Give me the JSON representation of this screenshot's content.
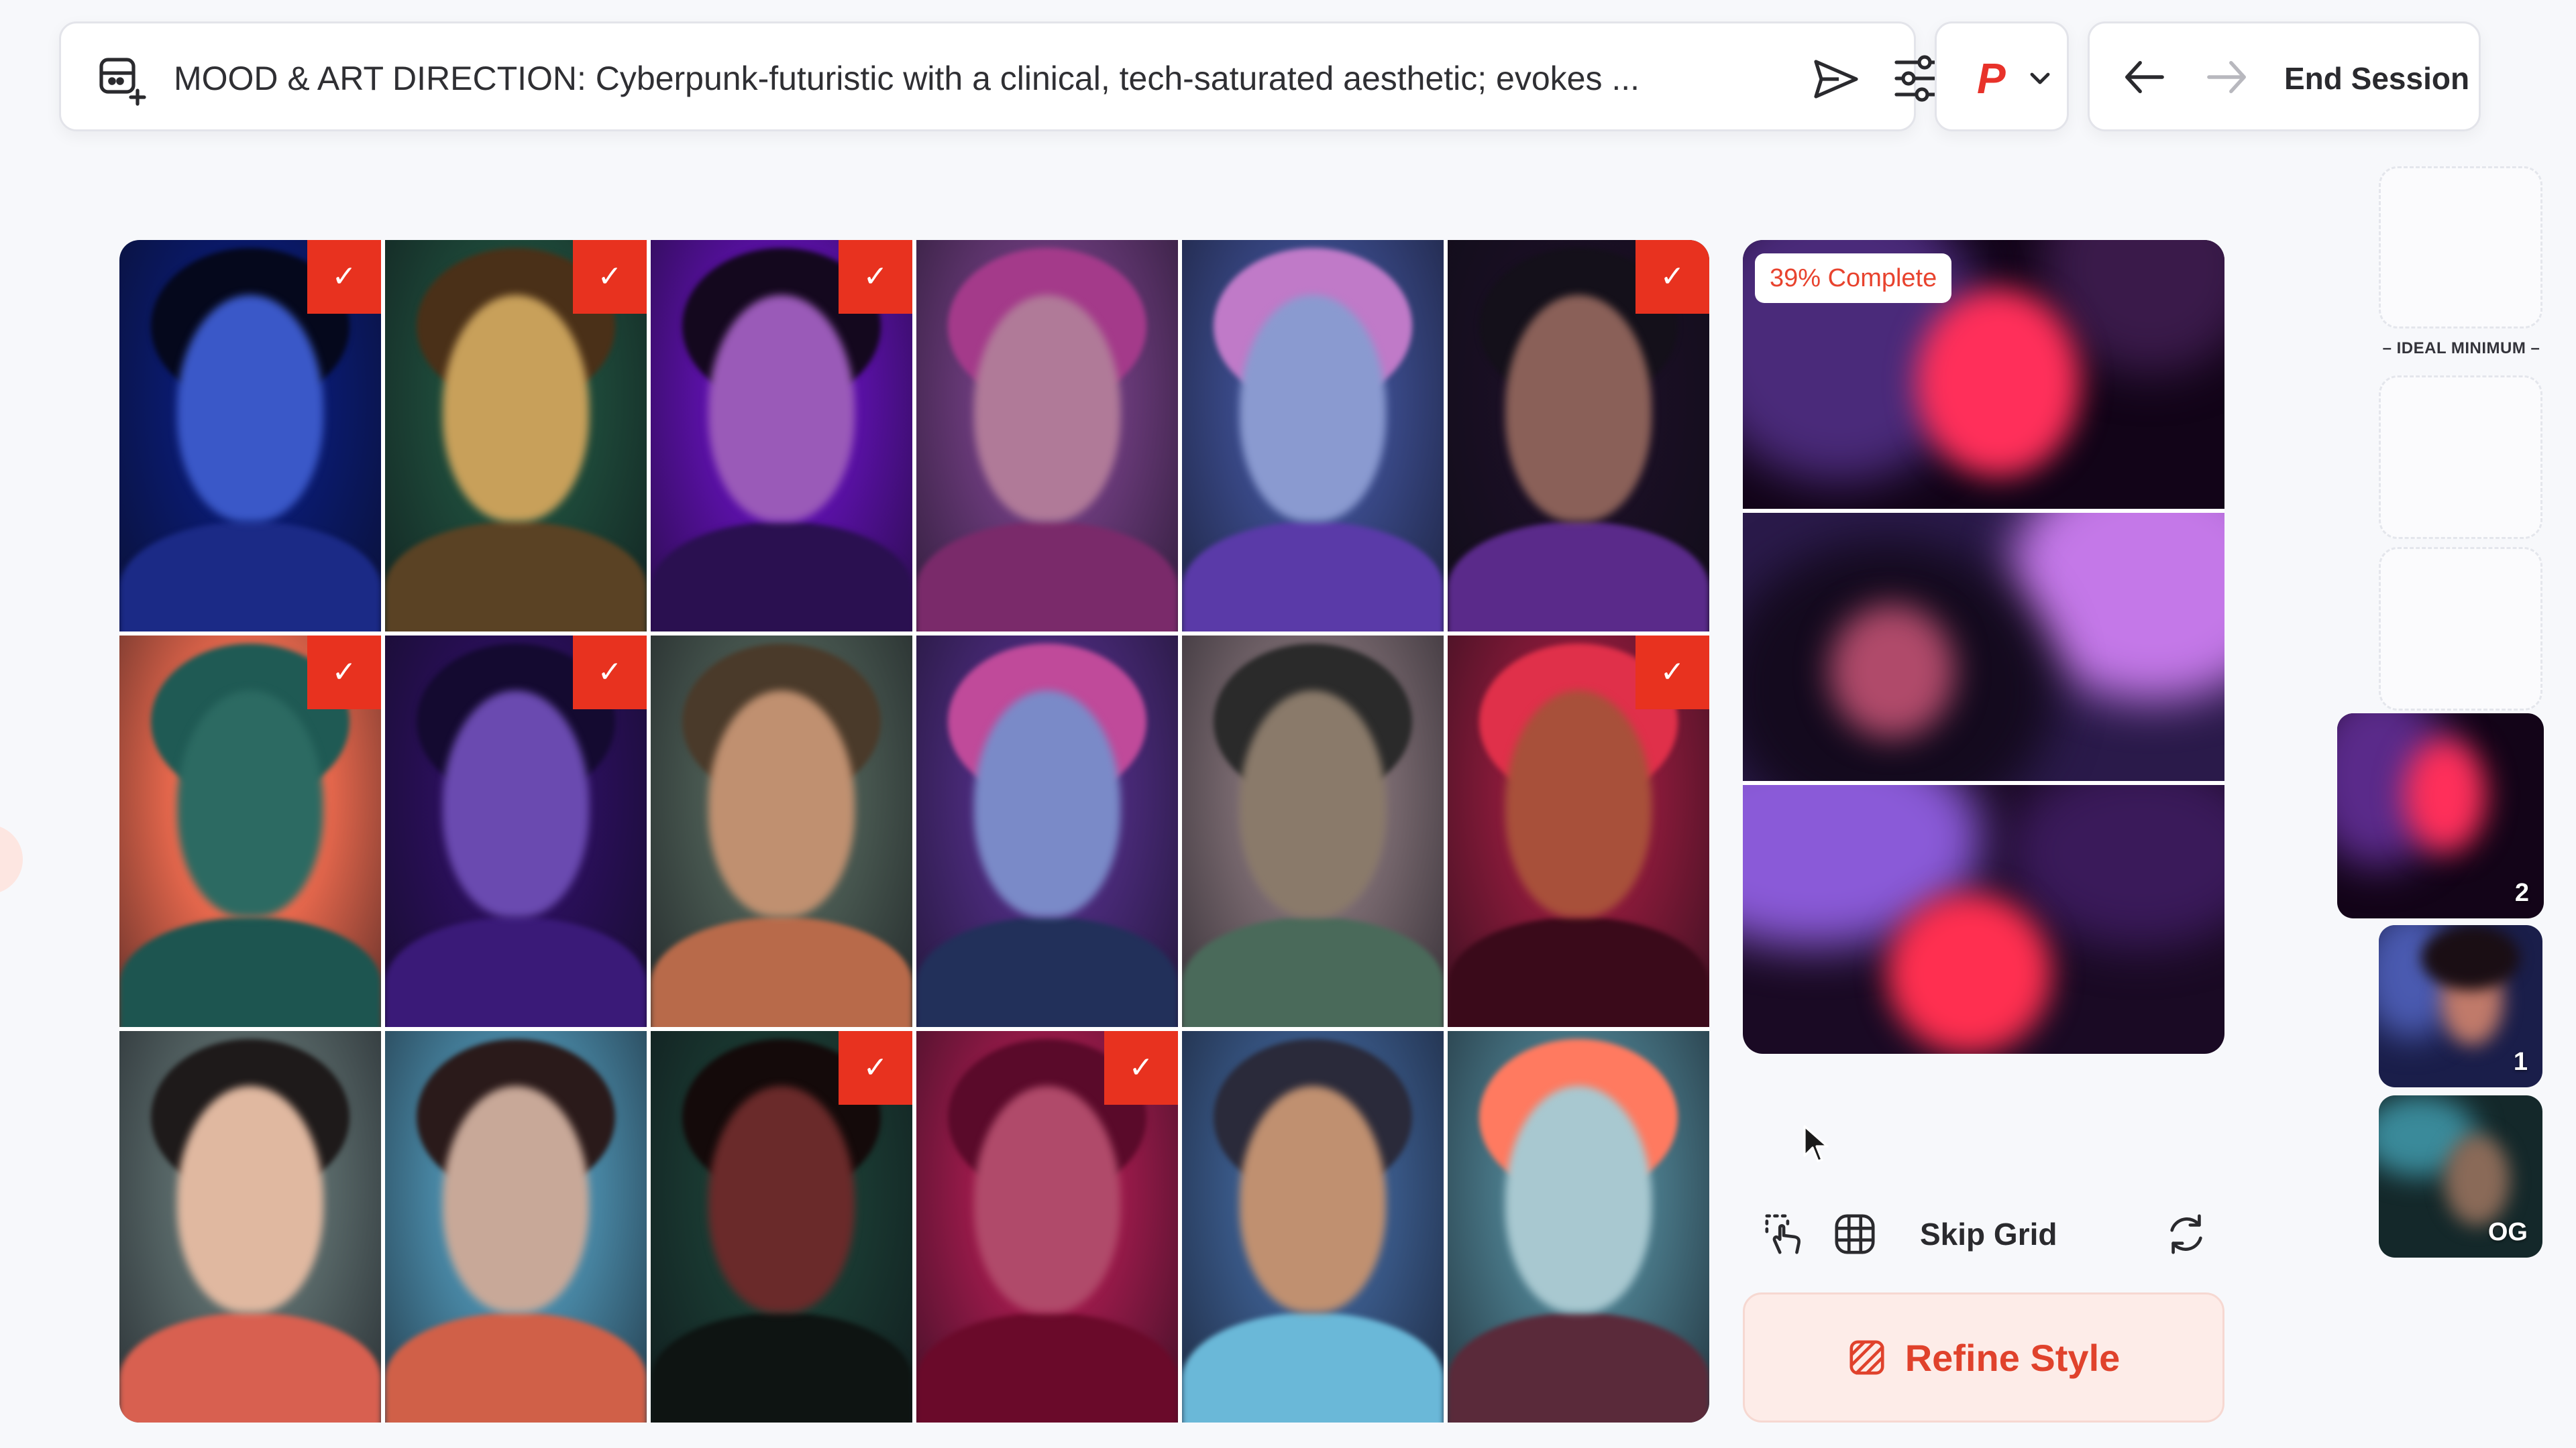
{
  "toolbar": {
    "prompt_text": "MOOD & ART DIRECTION: Cyberpunk-futuristic with a clinical, tech-saturated aesthetic; evokes ...",
    "new_icon": "new-canvas-icon",
    "send_icon": "send-icon",
    "settings_icon": "sliders-icon",
    "model_letter": "P",
    "end_session_label": "End Session"
  },
  "grid": {
    "tiles": [
      {
        "selected": true,
        "bg": "#0a1a6e",
        "face": "#3a58c8",
        "hair": "#05081c",
        "body": "#1b2a86"
      },
      {
        "selected": true,
        "bg": "#1e4a3a",
        "face": "#c8a05a",
        "hair": "#4a3018",
        "body": "#5a4224"
      },
      {
        "selected": true,
        "bg": "#5b10a8",
        "face": "#9a5ab8",
        "hair": "#14081e",
        "body": "#2a1050"
      },
      {
        "selected": false,
        "bg": "#6a3a7a",
        "face": "#b07a98",
        "hair": "#a43a8a",
        "body": "#7a2a6a"
      },
      {
        "selected": false,
        "bg": "#3a4a8a",
        "face": "#8a9ad0",
        "hair": "#c07ac8",
        "body": "#5a3aa8"
      },
      {
        "selected": true,
        "bg": "#1a0f24",
        "face": "#8a6058",
        "hair": "#14101a",
        "body": "#5a2a8a"
      },
      {
        "selected": true,
        "bg": "#ec6a4e",
        "face": "#2c6a62",
        "hair": "#1f5a54",
        "body": "#1d5550"
      },
      {
        "selected": true,
        "bg": "#2a0f5a",
        "face": "#6a4ab0",
        "hair": "#140a30",
        "body": "#3a1a78"
      },
      {
        "selected": false,
        "bg": "#4a5a52",
        "face": "#c09070",
        "hair": "#4a3a2a",
        "body": "#b86a4a"
      },
      {
        "selected": false,
        "bg": "#4a2a7a",
        "face": "#7a8ac8",
        "hair": "#c04a9a",
        "body": "#22305a"
      },
      {
        "selected": false,
        "bg": "#7a6a70",
        "face": "#8a7a6a",
        "hair": "#2a2a2a",
        "body": "#4a6a5a"
      },
      {
        "selected": true,
        "bg": "#8a1a3a",
        "face": "#a8503a",
        "hair": "#e0304a",
        "body": "#3a0a1a"
      },
      {
        "selected": false,
        "bg": "#5a6a6a",
        "face": "#e0b8a0",
        "hair": "#1e1a1a",
        "body": "#d86050"
      },
      {
        "selected": false,
        "bg": "#4a8aa8",
        "face": "#c8a898",
        "hair": "#2a1a1a",
        "body": "#d06048"
      },
      {
        "selected": true,
        "bg": "#1a3a32",
        "face": "#6a2a2a",
        "hair": "#140a0a",
        "body": "#0e1412"
      },
      {
        "selected": true,
        "bg": "#9a1a4a",
        "face": "#b04a6a",
        "hair": "#5a0a2a",
        "body": "#6a0a2a"
      },
      {
        "selected": false,
        "bg": "#3a5a8a",
        "face": "#c09070",
        "hair": "#2a2a3a",
        "body": "#6ab8d8"
      },
      {
        "selected": false,
        "bg": "#4a7a8a",
        "face": "#a8c8d0",
        "hair": "#ff7a60",
        "body": "#5a2a3a"
      }
    ]
  },
  "preview": {
    "progress_label": "39% Complete",
    "progress_percent": 39
  },
  "controls": {
    "select_icon": "tap-select-icon",
    "grid_icon": "grid-icon",
    "skip_label": "Skip Grid",
    "refresh_icon": "refresh-icon",
    "refine_label": "Refine Style",
    "refine_icon": "style-pattern-icon"
  },
  "rail": {
    "ideal_label": "IDEAL MINIMUM",
    "versions": [
      {
        "label": "2"
      },
      {
        "label": "1"
      },
      {
        "label": "OG"
      }
    ]
  },
  "colors": {
    "accent": "#e8321f",
    "accent_soft": "#fdece8"
  }
}
